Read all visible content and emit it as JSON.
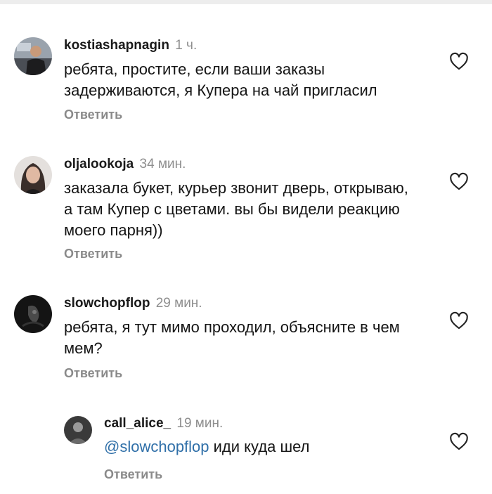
{
  "comments": [
    {
      "username": "kostiashapnagin",
      "time": "1 ч.",
      "text": "ребята, простите, если ваши заказы задерживаются, я Купера на чай пригласил",
      "reply_label": "Ответить",
      "avatar_icon": "user-photo-man-icon",
      "like_icon": "heart-outline-icon"
    },
    {
      "username": "oljalookoja",
      "time": "34 мин.",
      "text": "заказала букет, курьер звонит дверь, открываю, а там Купер с цветами. вы бы видели реакцию моего парня))",
      "reply_label": "Ответить",
      "avatar_icon": "user-photo-woman-icon",
      "like_icon": "heart-outline-icon"
    },
    {
      "username": "slowchopflop",
      "time": "29 мин.",
      "text": "ребята, я тут мимо проходил, объясните в чем мем?",
      "reply_label": "Ответить",
      "avatar_icon": "user-photo-dark-icon",
      "like_icon": "heart-outline-icon"
    }
  ],
  "reply_thread": {
    "username": "call_alice_",
    "time": "19 мин.",
    "mention": "@slowchopflop",
    "text": " иди куда шел",
    "reply_label": "Ответить",
    "avatar_icon": "user-photo-bw-icon",
    "like_icon": "heart-outline-icon"
  },
  "colors": {
    "mention": "#2f6fa8",
    "time": "#8e8e8e",
    "reply": "#8a8a8a"
  }
}
